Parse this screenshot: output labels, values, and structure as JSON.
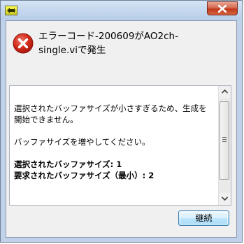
{
  "window": {
    "app_icon": "labview-app-icon",
    "close_icon": "close-icon"
  },
  "dialog": {
    "icon": "error-icon",
    "title_line1": "エラーコード-200609がAO2ch-",
    "title_line2": "single.viで発生",
    "message_lines": [
      "選択されたバッファサイズが小さすぎるため、生成を",
      "開始できません。",
      "",
      "バッファサイズを増やしてください。",
      "",
      "選択されたバッファサイズ: 1",
      "要求されたバッファサイズ（最小）: 2"
    ],
    "continue_label": "継続"
  },
  "colors": {
    "error_red": "#c81d11",
    "button_border": "#3c7fb1",
    "frame_blue": "#bfd2ea"
  }
}
